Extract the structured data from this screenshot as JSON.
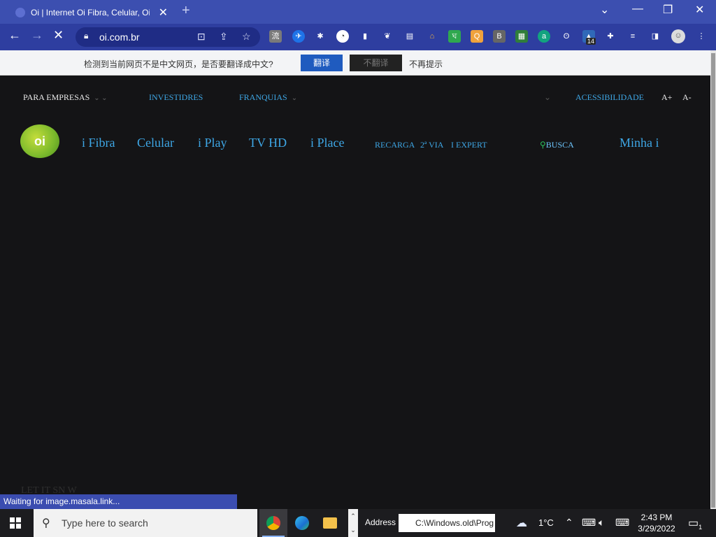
{
  "browser": {
    "tab_title": "Oi | Internet Oi Fibra, Celular, Oi Play e Mais",
    "url": "oi.com.br",
    "extension_badge": "14"
  },
  "translate_bar": {
    "message": "检测到当前网页不是中文网页，是否要翻译成中文?",
    "translate_button": "翻译",
    "dismiss_button": "不翻译",
    "never_link": "不再提示"
  },
  "site": {
    "top_nav": {
      "para_empresas": "PARA EMPRESAS",
      "investidores": "INVESTIDRES",
      "franquias": "FRANQUIAS",
      "acessibilidade": "ACESSIBILIDADE",
      "font_increase": "A+",
      "font_decrease": "A-"
    },
    "logo_text": "oi",
    "main_nav": {
      "fibra": "i Fibra",
      "celular": "Celular",
      "play": "i Play",
      "tvhd": "TV HD",
      "place": "i Place"
    },
    "sub_nav": {
      "recarga": "RECARGA",
      "segunda_via": "2ª VIA",
      "expert": "I EXPERT"
    },
    "busca": "BUSCA",
    "minha": "Minha  i",
    "snow_text": "LET IT SN W"
  },
  "status_bubble": "Waiting for image.masala.link...",
  "taskbar": {
    "search_placeholder": "Type here to search",
    "address_label": "Address",
    "address_value": "C:\\Windows.old\\Prog",
    "temperature": "1°C",
    "time": "2:43 PM",
    "date": "3/29/2022",
    "notification_count": "1"
  },
  "colors": {
    "title_bar": "#3c4fb0",
    "toolbar": "#2e3ea0",
    "page_background": "#141416",
    "link_blue": "#3ea7e6",
    "brand_green": "#7ab92c",
    "translate_button": "#1f5bbf"
  }
}
